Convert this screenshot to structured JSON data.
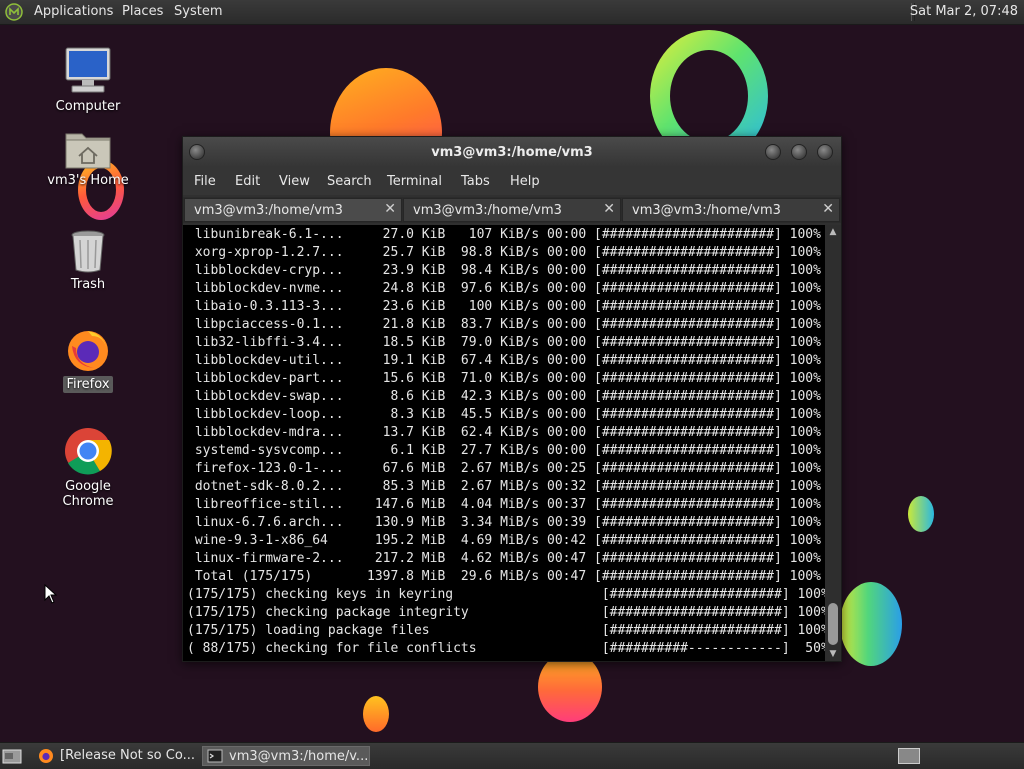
{
  "top_panel": {
    "menus": [
      "Applications",
      "Places",
      "System"
    ],
    "clock": "Sat Mar 2, 07:48"
  },
  "desktop": {
    "icons": [
      {
        "label": "Computer",
        "icon": "computer-icon"
      },
      {
        "label": "vm3's Home",
        "icon": "home-folder-icon"
      },
      {
        "label": "Trash",
        "icon": "trash-icon"
      },
      {
        "label": "Firefox",
        "icon": "firefox-icon"
      },
      {
        "label": "Google Chrome",
        "icon": "chrome-icon"
      }
    ]
  },
  "window": {
    "title": "vm3@vm3:/home/vm3",
    "menu": [
      "File",
      "Edit",
      "View",
      "Search",
      "Terminal",
      "Tabs",
      "Help"
    ],
    "tabs": [
      {
        "label": "vm3@vm3:/home/vm3",
        "active": true
      },
      {
        "label": "vm3@vm3:/home/vm3",
        "active": false
      },
      {
        "label": "vm3@vm3:/home/vm3",
        "active": false
      }
    ],
    "terminal_lines": [
      " libunibreak-6.1-...     27.0 KiB   107 KiB/s 00:00 [######################] 100%",
      " xorg-xprop-1.2.7...     25.7 KiB  98.8 KiB/s 00:00 [######################] 100%",
      " libblockdev-cryp...     23.9 KiB  98.4 KiB/s 00:00 [######################] 100%",
      " libblockdev-nvme...     24.8 KiB  97.6 KiB/s 00:00 [######################] 100%",
      " libaio-0.3.113-3...     23.6 KiB   100 KiB/s 00:00 [######################] 100%",
      " libpciaccess-0.1...     21.8 KiB  83.7 KiB/s 00:00 [######################] 100%",
      " lib32-libffi-3.4...     18.5 KiB  79.0 KiB/s 00:00 [######################] 100%",
      " libblockdev-util...     19.1 KiB  67.4 KiB/s 00:00 [######################] 100%",
      " libblockdev-part...     15.6 KiB  71.0 KiB/s 00:00 [######################] 100%",
      " libblockdev-swap...      8.6 KiB  42.3 KiB/s 00:00 [######################] 100%",
      " libblockdev-loop...      8.3 KiB  45.5 KiB/s 00:00 [######################] 100%",
      " libblockdev-mdra...     13.7 KiB  62.4 KiB/s 00:00 [######################] 100%",
      " systemd-sysvcomp...      6.1 KiB  27.7 KiB/s 00:00 [######################] 100%",
      " firefox-123.0-1-...     67.6 MiB  2.67 MiB/s 00:25 [######################] 100%",
      " dotnet-sdk-8.0.2...     85.3 MiB  2.67 MiB/s 00:32 [######################] 100%",
      " libreoffice-stil...    147.6 MiB  4.04 MiB/s 00:37 [######################] 100%",
      " linux-6.7.6.arch...    130.9 MiB  3.34 MiB/s 00:39 [######################] 100%",
      " wine-9.3-1-x86_64      195.2 MiB  4.69 MiB/s 00:42 [######################] 100%",
      " linux-firmware-2...    217.2 MiB  4.62 MiB/s 00:47 [######################] 100%",
      " Total (175/175)       1397.8 MiB  29.6 MiB/s 00:47 [######################] 100%",
      "(175/175) checking keys in keyring                   [######################] 100%",
      "(175/175) checking package integrity                 [######################] 100%",
      "(175/175) loading package files                      [######################] 100%",
      "( 88/175) checking for file conflicts                [##########------------]  50%"
    ]
  },
  "taskbar": {
    "tasks": [
      {
        "label": "[Release Not so Co...",
        "icon": "firefox-icon",
        "active": false
      },
      {
        "label": "vm3@vm3:/home/v...",
        "icon": "terminal-icon",
        "active": true
      }
    ]
  },
  "colors": {
    "desktop_bg": "#23101f",
    "panel_bg": "#2f2f2f",
    "terminal_bg": "#000000",
    "terminal_fg": "#e6e6e6"
  }
}
